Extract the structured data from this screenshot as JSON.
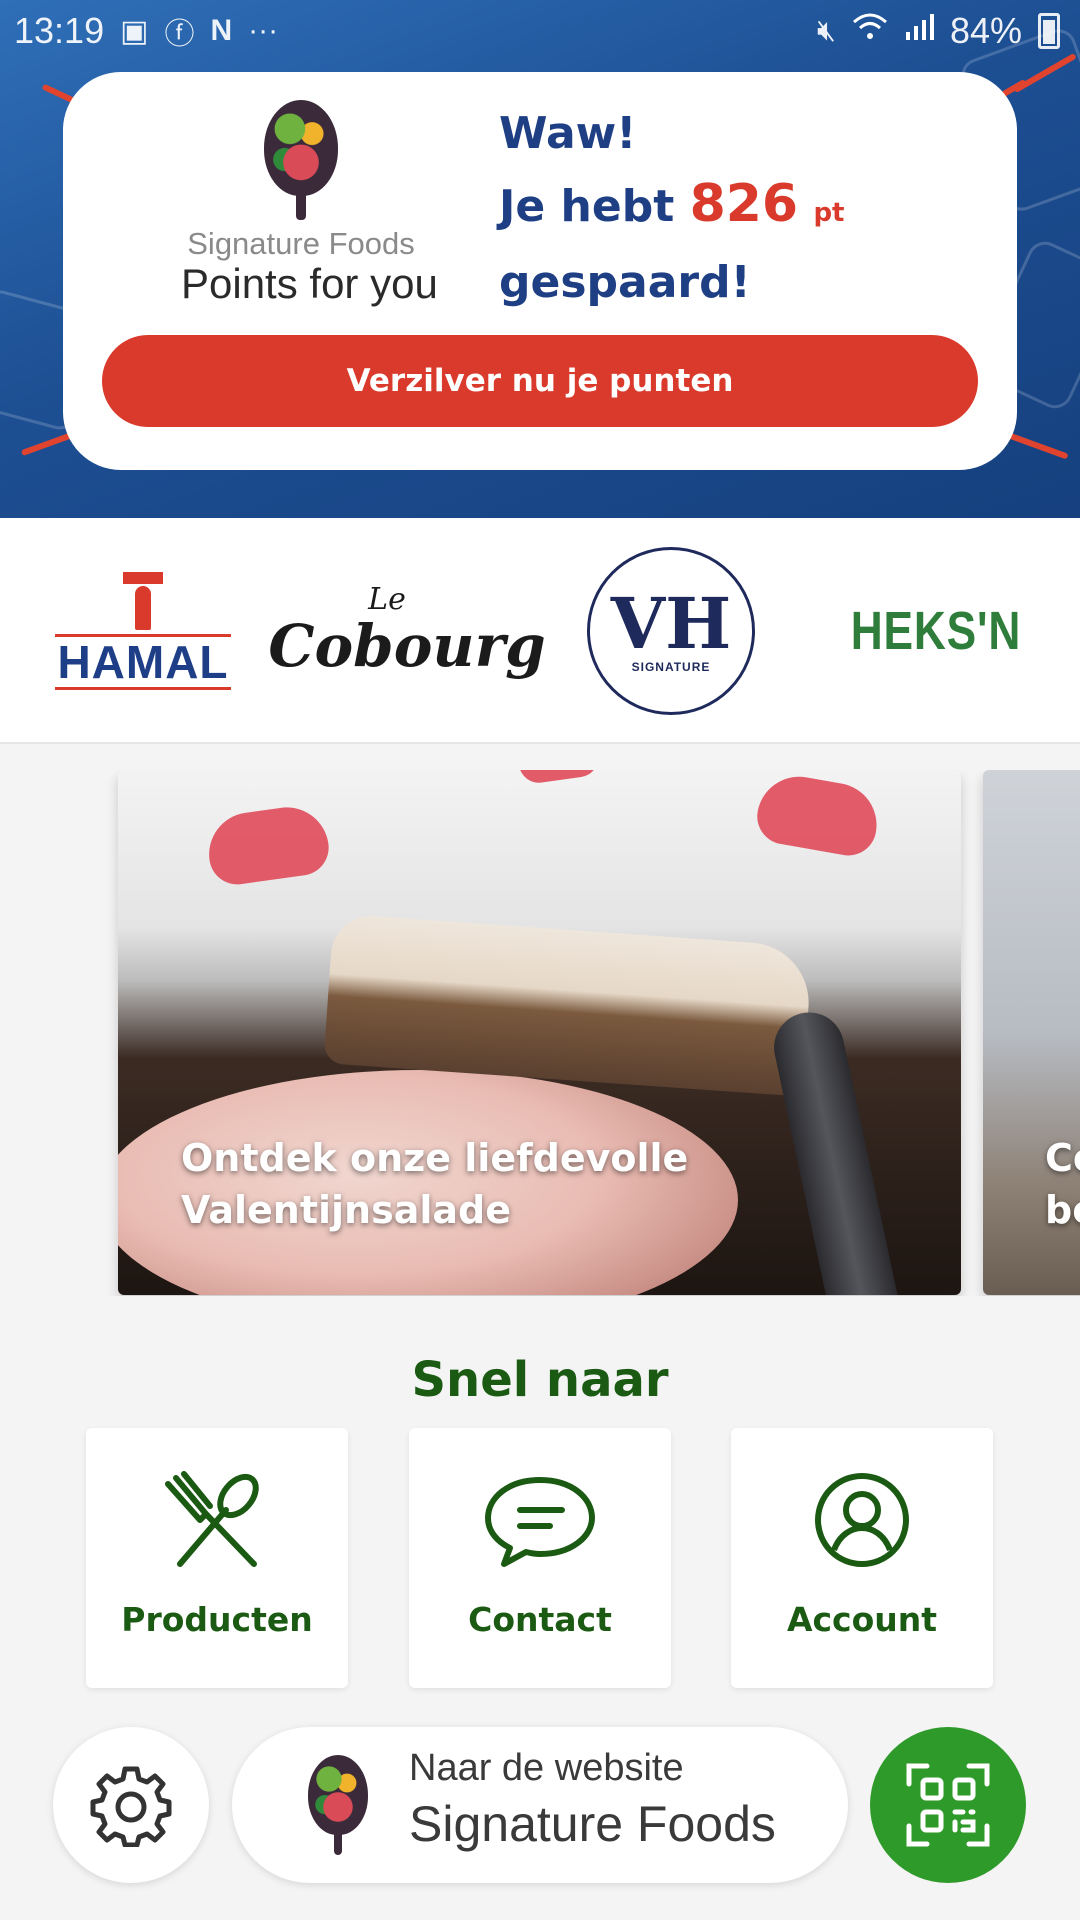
{
  "status_bar": {
    "time": "13:19",
    "notification_icons": [
      "gallery-icon",
      "facebook-icon",
      "netflix-icon",
      "more-icon"
    ],
    "system_icons": [
      "mute-icon",
      "wifi-icon",
      "signal-icon"
    ],
    "battery": "84%"
  },
  "points_card": {
    "brand_line1": "Signature Foods",
    "brand_line2": "Points for you",
    "exclaim": "Waw!",
    "you_have": "Je hebt",
    "points": "826",
    "unit": "pt",
    "saved": "gespaard!",
    "redeem_label": "Verzilver nu je punten"
  },
  "brands": {
    "items": [
      {
        "name": "HAMAL"
      },
      {
        "name_small": "Le",
        "name_large": "Cobourg"
      },
      {
        "name": "VH",
        "sub": "SIGNATURE"
      },
      {
        "name": "HEKS'N"
      }
    ]
  },
  "carousel": {
    "slides": [
      {
        "title": "Ontdek onze liefdevolle Valentijnsalade"
      },
      {
        "title_line1": "Co",
        "title_line2": "be"
      }
    ]
  },
  "quick": {
    "title": "Snel naar",
    "tiles": [
      {
        "label": "Producten",
        "icon": "cutlery-icon"
      },
      {
        "label": "Contact",
        "icon": "chat-bubble-icon"
      },
      {
        "label": "Account",
        "icon": "user-icon"
      }
    ]
  },
  "bottom": {
    "settings_icon": "gear-icon",
    "website_line1": "Naar de website",
    "website_line2": "Signature Foods",
    "qr_icon": "qr-scan-icon"
  },
  "colors": {
    "hero_blue": "#1d4f93",
    "accent_red": "#d93a2c",
    "brand_green": "#1b5a12",
    "qr_green": "#2e9a2a"
  }
}
